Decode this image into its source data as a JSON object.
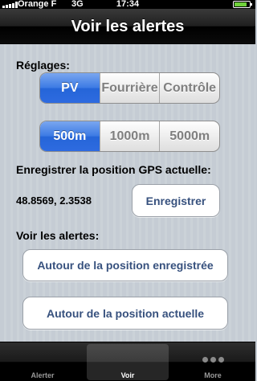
{
  "status_bar": {
    "carrier": "Orange F",
    "network": "3G",
    "time": "17:34",
    "battery_level": 0.85,
    "battery_color": "#6fd13b"
  },
  "nav": {
    "title": "Voir les alertes"
  },
  "settings": {
    "label": "Réglages:",
    "type_options": [
      "PV",
      "Fourrière",
      "Contrôle"
    ],
    "type_selected": "PV",
    "distance_options": [
      "500m",
      "1000m",
      "5000m"
    ],
    "distance_selected": "500m"
  },
  "gps": {
    "label": "Enregistrer la position GPS actuelle:",
    "coords": "48.8569, 2.3538",
    "save_button": "Enregistrer"
  },
  "alerts": {
    "label": "Voir les alertes:",
    "around_saved_button": "Autour de la position enregistrée",
    "around_current_button": "Autour de la position actuelle"
  },
  "tabbar": {
    "tabs": [
      {
        "label": "Alerter"
      },
      {
        "label": "Voir"
      },
      {
        "label": "More"
      }
    ],
    "active": "Voir"
  },
  "colors": {
    "selected_segment": "#2e6be0",
    "button_text": "#37517e"
  }
}
